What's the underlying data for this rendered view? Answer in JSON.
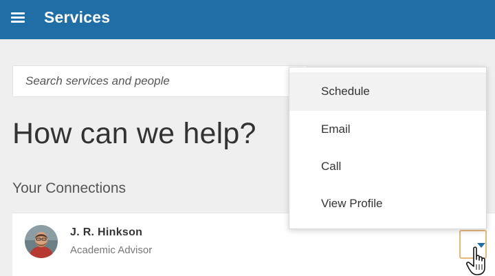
{
  "header": {
    "title": "Services",
    "menu_icon": "hamburger-menu-icon",
    "background": "#1f6ea5"
  },
  "search": {
    "placeholder": "Search services and people",
    "value": ""
  },
  "main": {
    "heading": "How can we help?",
    "connections_title": "Your Connections"
  },
  "connection": {
    "name": "J. R. Hinkson",
    "role": "Academic Advisor",
    "avatar_icon": "profile-photo",
    "dropdown_icon": "caret-down-icon"
  },
  "dropdown": {
    "items": [
      {
        "label": "Schedule",
        "active": true
      },
      {
        "label": "Email",
        "active": false
      },
      {
        "label": "Call",
        "active": false
      },
      {
        "label": "View Profile",
        "active": false
      }
    ]
  },
  "colors": {
    "accent": "#1f6ea5",
    "toggle_border": "#e8b677"
  }
}
